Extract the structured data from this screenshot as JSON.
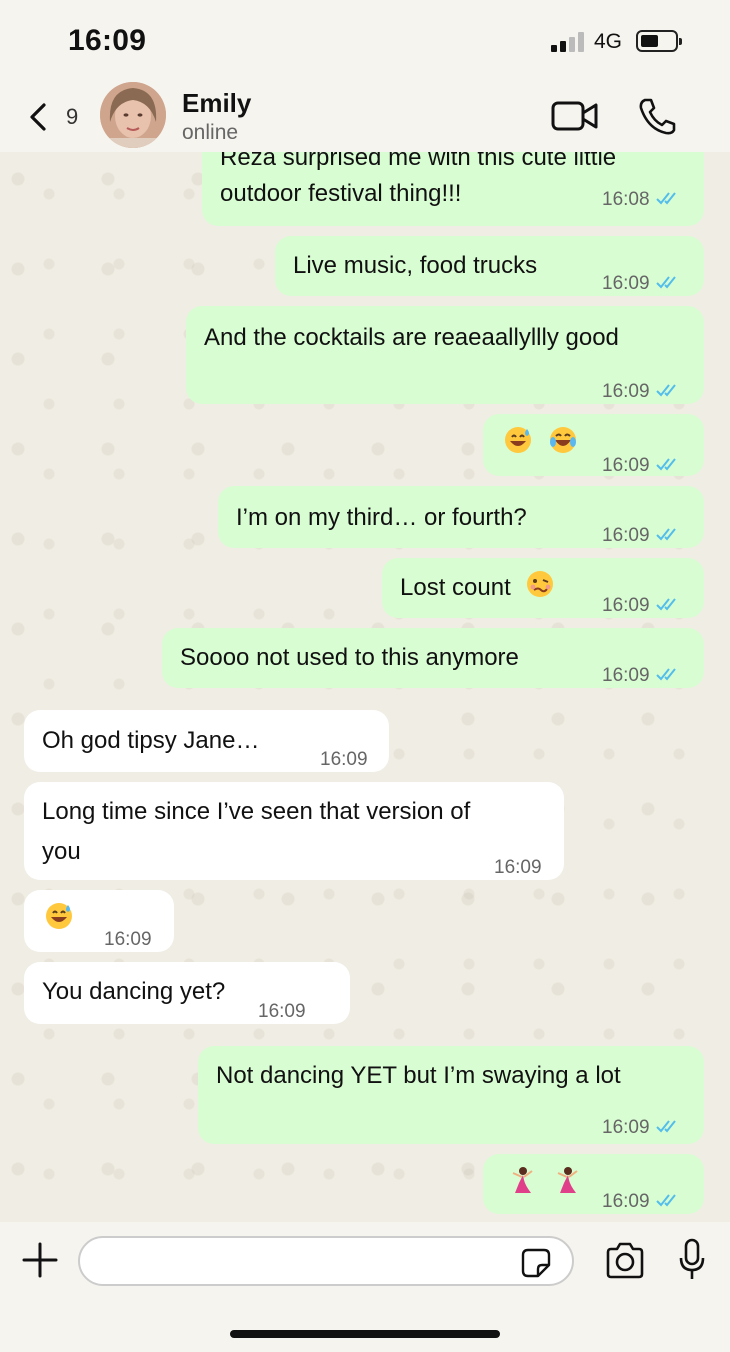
{
  "status_bar": {
    "time": "16:09",
    "network": "4G",
    "signal_bars": 2,
    "battery_level": 0.45
  },
  "header": {
    "back_count": "9",
    "contact_name": "Emily",
    "contact_status": "online"
  },
  "messages": [
    {
      "text": "Reza surprised me with this cute little",
      "text2": "outdoor festival thing!!!",
      "time": "16:08",
      "dir": "out"
    },
    {
      "text": "Live music, food trucks",
      "time": "16:09",
      "dir": "out"
    },
    {
      "text": "And the cocktails are reaeaallyllly good",
      "time": "16:09",
      "dir": "out"
    },
    {
      "emoji": [
        "sweat-smile-emoji",
        "tears-of-joy-emoji"
      ],
      "time": "16:09",
      "dir": "out"
    },
    {
      "text": "I’m on my third… or fourth?",
      "time": "16:09",
      "dir": "out"
    },
    {
      "text": "Lost count",
      "emoji": [
        "woozy-face-emoji"
      ],
      "time": "16:09",
      "dir": "out"
    },
    {
      "text": "Soooo not used to this anymore",
      "time": "16:09",
      "dir": "out"
    },
    {
      "text": "Oh god tipsy Jane…",
      "time": "16:09",
      "dir": "in"
    },
    {
      "text": "Long time since I’ve seen that version of",
      "text2": "you",
      "time": "16:09",
      "dir": "in"
    },
    {
      "emoji": [
        "sweat-smile-emoji"
      ],
      "time": "16:09",
      "dir": "in"
    },
    {
      "text": "You dancing yet?",
      "time": "16:09",
      "dir": "in"
    },
    {
      "text": "Not dancing YET but I’m swaying a lot",
      "time": "16:09",
      "dir": "out"
    },
    {
      "emoji": [
        "dancer-emoji",
        "dancer-emoji"
      ],
      "time": "16:09",
      "dir": "out"
    }
  ],
  "input": {
    "placeholder": ""
  },
  "colors": {
    "outgoing": "#d9fdd3",
    "incoming": "#ffffff",
    "read_ticks": "#53bdeb",
    "background": "#f0ede4"
  }
}
